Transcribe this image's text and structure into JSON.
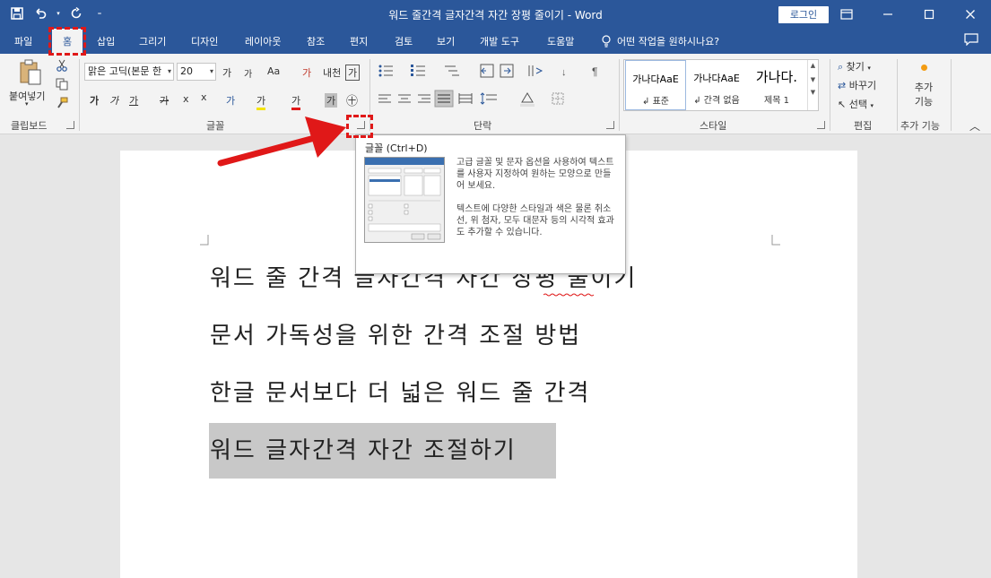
{
  "window": {
    "title": "워드 줄간격 글자간격 자간 장평 줄이기 - Word",
    "login_label": "로그인"
  },
  "tabs": [
    {
      "label": "파일"
    },
    {
      "label": "홈",
      "active": true
    },
    {
      "label": "삽입"
    },
    {
      "label": "그리기"
    },
    {
      "label": "디자인"
    },
    {
      "label": "레이아웃"
    },
    {
      "label": "참조"
    },
    {
      "label": "편지"
    },
    {
      "label": "검토"
    },
    {
      "label": "보기"
    },
    {
      "label": "개발 도구"
    },
    {
      "label": "도움말"
    }
  ],
  "tell_me": "어떤 작업을 원하시나요?",
  "ribbon": {
    "clipboard": {
      "paste_label": "붙여넣기",
      "group_label": "클립보드"
    },
    "font": {
      "font_name": "맑은 고딕(본문 한",
      "font_size": "20",
      "grow": "가",
      "shrink": "가",
      "case": "Aa",
      "clear": "가",
      "phonetic": "내천",
      "border": "가",
      "bold": "가",
      "italic": "가",
      "underline": "가",
      "strike": "가",
      "subscript": "x",
      "superscript": "x",
      "effects": "가",
      "highlight": "가",
      "color": "가",
      "shade": "가",
      "enclose": "㊉",
      "group_label": "글꼴"
    },
    "paragraph": {
      "group_label": "단락"
    },
    "styles": {
      "items": [
        {
          "sample": "가나다AaE",
          "name": "↲ 표준"
        },
        {
          "sample": "가나다AaE",
          "name": "↲ 간격 없음"
        },
        {
          "sample": "가나다.",
          "name": "제목 1"
        }
      ],
      "group_label": "스타일"
    },
    "editing": {
      "find": "찾기",
      "replace": "바꾸기",
      "select": "선택",
      "group_label": "편집"
    },
    "addins": {
      "label_line1": "추가",
      "label_line2": "기능",
      "group_label": "추가 기능"
    }
  },
  "tooltip": {
    "title": "글꼴 (Ctrl+D)",
    "desc1": "고급 글꼴 및 문자 옵션을 사용하여 텍스트를 사용자 지정하여 원하는 모양으로 만들어 보세요.",
    "desc2": "텍스트에 다양한 스타일과 색은 물론 취소선, 위 첨자, 모두 대문자 등의 시각적 효과도 추가할 수 있습니다."
  },
  "document": {
    "lines": [
      "워드 줄 간격 글자간격 자간 장평 줄이기",
      "문서 가독성을 위한 간격 조절 방법",
      "한글 문서보다 더 넓은 워드 줄 간격",
      "워드 글자간격 자간 조절하기"
    ]
  },
  "colors": {
    "accent": "#2b579a",
    "highlight": "#e01818",
    "selection": "#c8c8c8"
  }
}
